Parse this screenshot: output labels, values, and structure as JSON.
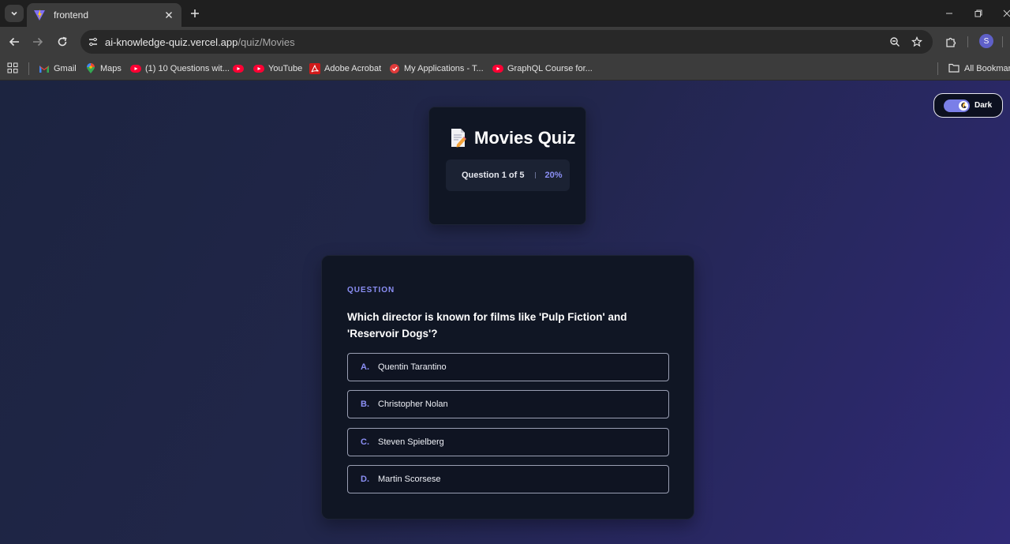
{
  "browser": {
    "tab_title": "frontend",
    "url_host": "ai-knowledge-quiz.vercel.app",
    "url_path": "/quiz/Movies",
    "profile_initial": "S",
    "bookmarks": [
      {
        "label": "Gmail",
        "icon": "gmail-icon"
      },
      {
        "label": "Maps",
        "icon": "maps-icon"
      },
      {
        "label": "(1) 10 Questions wit...",
        "icon": "youtube-icon"
      },
      {
        "label": "",
        "icon": "youtube-icon"
      },
      {
        "label": "YouTube",
        "icon": "youtube-icon"
      },
      {
        "label": "Adobe Acrobat",
        "icon": "acrobat-icon"
      },
      {
        "label": "My Applications - T...",
        "icon": "applications-icon"
      },
      {
        "label": "GraphQL Course for...",
        "icon": "youtube-icon"
      }
    ],
    "all_bookmarks_label": "All Bookmarks"
  },
  "page": {
    "theme_toggle_label": "Dark",
    "quiz_title": "Movies Quiz",
    "progress_text": "Question 1 of 5",
    "progress_percent": "20%",
    "progress_fraction": 0.2,
    "question_label": "QUESTION",
    "question_text": "Which director is known for films like 'Pulp Fiction' and 'Reservoir Dogs'?",
    "options": [
      {
        "letter": "A.",
        "text": "Quentin Tarantino"
      },
      {
        "letter": "B.",
        "text": "Christopher Nolan"
      },
      {
        "letter": "C.",
        "text": "Steven Spielberg"
      },
      {
        "letter": "D.",
        "text": "Martin Scorsese"
      }
    ]
  },
  "colors": {
    "accent": "#8b8ff5",
    "card_bg": "#101624",
    "page_gradient_start": "#1c2440",
    "page_gradient_end": "#302a78"
  }
}
